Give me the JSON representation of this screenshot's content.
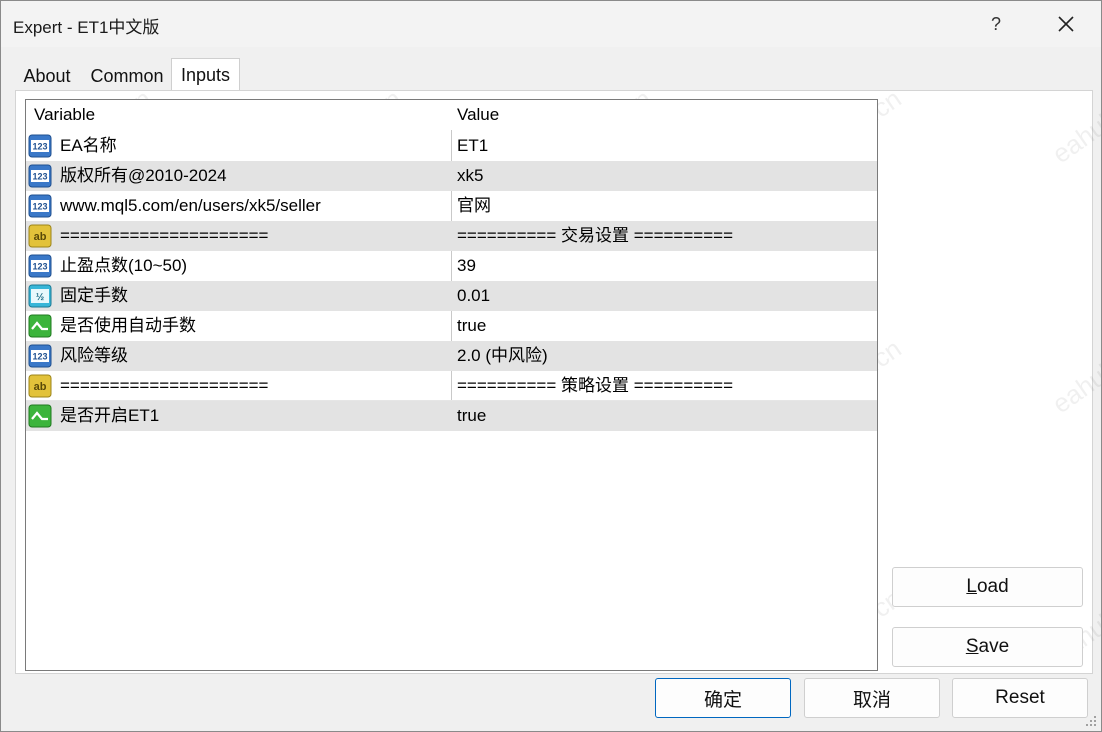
{
  "window": {
    "title": "Expert - ET1中文版",
    "help_label": "?"
  },
  "tabs": [
    {
      "label": "About",
      "active": false
    },
    {
      "label": "Common",
      "active": false
    },
    {
      "label": "Inputs",
      "active": true
    }
  ],
  "grid": {
    "headers": {
      "variable": "Variable",
      "value": "Value"
    },
    "rows": [
      {
        "icon": "integer-type-icon",
        "variable": "EA名称",
        "value": "ET1"
      },
      {
        "icon": "integer-type-icon",
        "variable": "版权所有@2010-2024",
        "value": "xk5"
      },
      {
        "icon": "integer-type-icon",
        "variable": "www.mql5.com/en/users/xk5/seller",
        "value": "官网"
      },
      {
        "icon": "string-type-icon",
        "variable": "=====================",
        "value": "========== 交易设置 =========="
      },
      {
        "icon": "integer-type-icon",
        "variable": "止盈点数(10~50)",
        "value": "39"
      },
      {
        "icon": "double-type-icon",
        "variable": "固定手数",
        "value": "0.01"
      },
      {
        "icon": "boolean-type-icon",
        "variable": "是否使用自动手数",
        "value": "true"
      },
      {
        "icon": "integer-type-icon",
        "variable": "风险等级",
        "value": "2.0 (中风险)"
      },
      {
        "icon": "string-type-icon",
        "variable": "=====================",
        "value": "========== 策略设置 =========="
      },
      {
        "icon": "boolean-type-icon",
        "variable": "是否开启ET1",
        "value": "true"
      }
    ]
  },
  "buttons": {
    "load": {
      "mnemonic": "L",
      "rest": "oad"
    },
    "save": {
      "mnemonic": "S",
      "rest": "ave"
    },
    "ok": "确定",
    "cancel": "取消",
    "reset": "Reset"
  },
  "watermark_text": "eahub.cn",
  "colors": {
    "integer_icon": "#3a78c8",
    "string_icon": "#e2c23a",
    "double_icon": "#38b6d8",
    "boolean_icon": "#3cb43c",
    "primary_border": "#0067c0"
  }
}
